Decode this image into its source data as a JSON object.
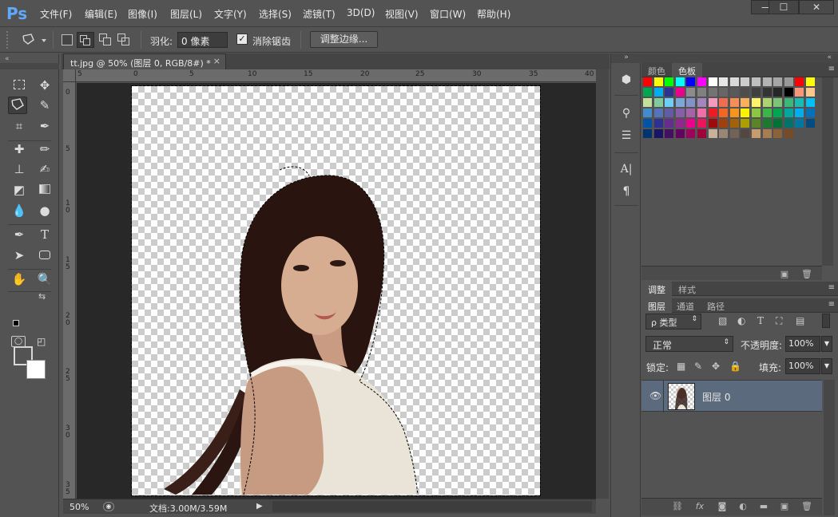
{
  "app": {
    "logo": "Ps",
    "menus": [
      "文件(F)",
      "编辑(E)",
      "图像(I)",
      "图层(L)",
      "文字(Y)",
      "选择(S)",
      "滤镜(T)",
      "3D(D)",
      "视图(V)",
      "窗口(W)",
      "帮助(H)"
    ],
    "window_buttons": [
      "—",
      "☐",
      "✕"
    ]
  },
  "options_bar": {
    "feather_label": "羽化:",
    "feather_value": "0 像素",
    "antialias_label": "消除锯齿",
    "antialias_checked": "✓",
    "refine_edge_label": "调整边缘..."
  },
  "document": {
    "tab_title": "tt.jpg @ 50% (图层 0, RGB/8#) *",
    "tab_close": "×",
    "ruler_top_labels": [
      "5",
      "0",
      "5",
      "10",
      "15",
      "20",
      "25",
      "30",
      "35",
      "40"
    ],
    "ruler_left_labels": [
      "0",
      "5",
      "1\n0",
      "1\n5",
      "2\n0",
      "2\n5",
      "3\n0",
      "3\n5"
    ],
    "zoom": "50%",
    "doc_size": "文档:3.00M/3.59M"
  },
  "panels": {
    "top_tabs": [
      "颜色",
      "色板"
    ],
    "top_active": "色板",
    "adjust_tabs": [
      "调整",
      "样式"
    ],
    "layer_tabs": [
      "图层",
      "通道",
      "路径"
    ],
    "layer_active": "图层",
    "kind_label": "ρ 类型",
    "blend_mode": "正常",
    "opacity_label": "不透明度:",
    "opacity_value": "100%",
    "lock_label": "锁定:",
    "fill_label": "填充:",
    "fill_value": "100%",
    "layer_name": "图层 0"
  },
  "colors": {
    "accent_logo": "#5fa8ff",
    "selected_layer": "#5b6a7d"
  }
}
